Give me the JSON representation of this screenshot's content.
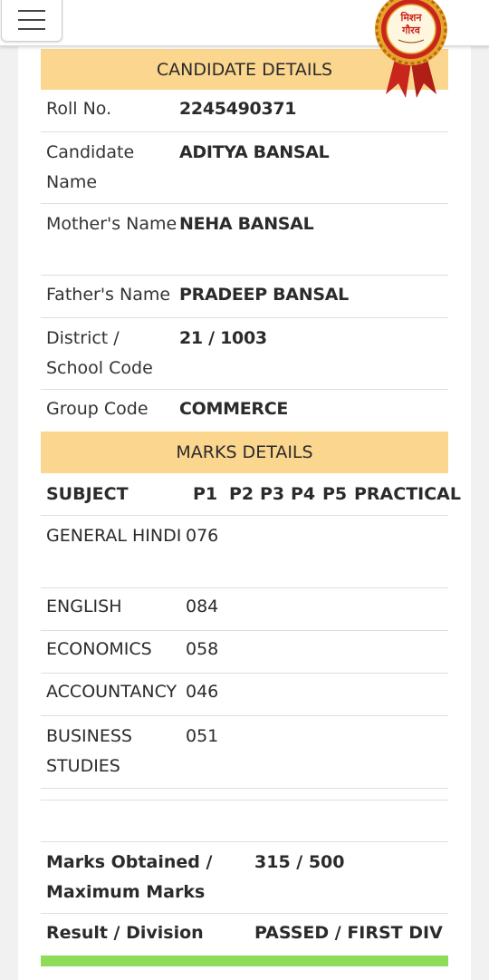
{
  "badge": {
    "line1": "मिशन",
    "line2": "गौरव"
  },
  "candidate": {
    "header": "CANDIDATE DETAILS",
    "rows": [
      {
        "label": "Roll No.",
        "value": "2245490371"
      },
      {
        "label": "Candidate Name",
        "value": "ADITYA BANSAL"
      },
      {
        "label": "Mother's Name",
        "value": "NEHA BANSAL"
      },
      {
        "label": "Father's Name",
        "value": "PRADEEP BANSAL"
      },
      {
        "label": "District / School Code",
        "value": "21 / 1003"
      },
      {
        "label": "Group Code",
        "value": "COMMERCE"
      }
    ]
  },
  "marks": {
    "header": "MARKS DETAILS",
    "columns": [
      "SUBJECT",
      "P1",
      "P2",
      "P3",
      "P4",
      "P5",
      "PRACTICAL"
    ],
    "rows": [
      {
        "subject": "GENERAL HINDI",
        "p1": "076"
      },
      {
        "subject": "ENGLISH",
        "p1": "084"
      },
      {
        "subject": "ECONOMICS",
        "p1": "058"
      },
      {
        "subject": "ACCOUNTANCY",
        "p1": "046"
      },
      {
        "subject": "BUSINESS STUDIES",
        "p1": "051"
      }
    ]
  },
  "summary": {
    "marks_label": "Marks Obtained / Maximum Marks",
    "marks_value": "315 / 500",
    "result_label": "Result / Division",
    "result_value": "PASSED / FIRST DIV"
  },
  "colors": {
    "section_header": "#fbd68f",
    "status_bar": "#8fdc58",
    "badge_red": "#c8251d",
    "badge_gold": "#e8a42a"
  }
}
